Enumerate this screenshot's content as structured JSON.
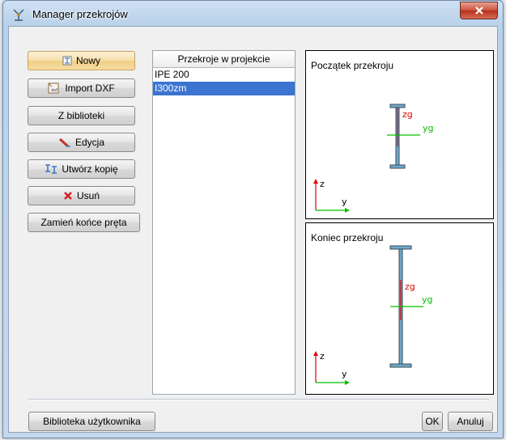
{
  "window": {
    "title": "Manager przekrojów",
    "close_glyph": "x"
  },
  "buttons": {
    "new": "Nowy",
    "import_dxf": "Import DXF",
    "from_library": "Z biblioteki",
    "edit": "Edycja",
    "copy": "Utwórz kopię",
    "delete": "Usuń",
    "swap_ends": "Zamień końce pręta"
  },
  "sections": {
    "header": "Przekroje w projekcie",
    "items": [
      "IPE 200",
      "I300zm"
    ],
    "selected": "I300zm"
  },
  "preview_start": {
    "label": "Początek przekroju",
    "z_axis": "z",
    "y_axis": "y",
    "zg": "zg",
    "yg": "yg"
  },
  "preview_end": {
    "label": "Koniec przekroju",
    "z_axis": "z",
    "y_axis": "y",
    "zg": "zg",
    "yg": "yg"
  },
  "footer": {
    "user_library": "Biblioteka użytkownika",
    "ok": "OK",
    "cancel": "Anuluj"
  },
  "colors": {
    "selection": "#3b74d1",
    "axis_green": "#00c000",
    "axis_red": "#e00000",
    "section_fill": "#6ea9c9",
    "section_outline": "#3a4a5a"
  }
}
